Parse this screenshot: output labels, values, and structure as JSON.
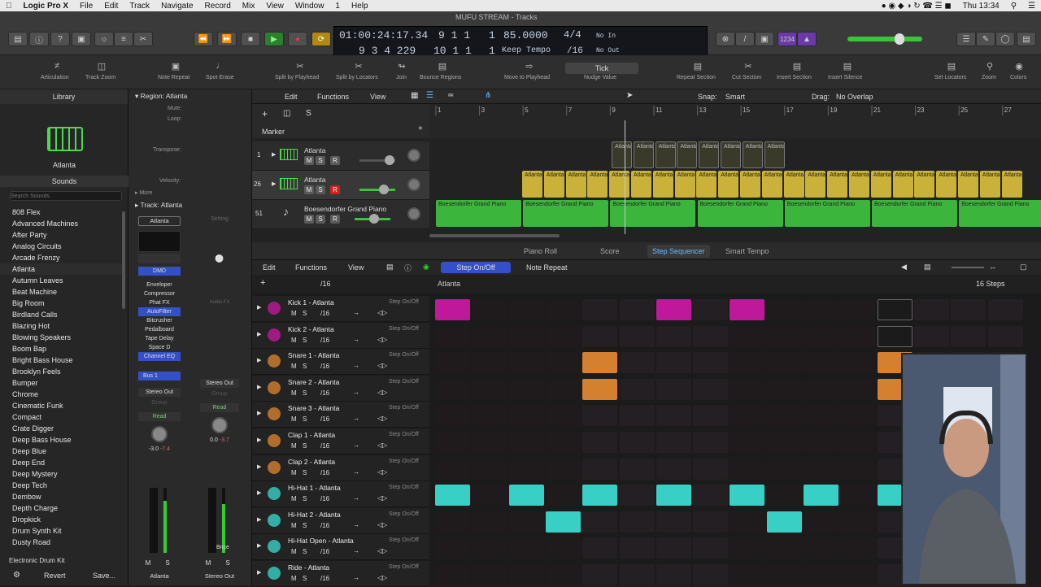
{
  "menubar": {
    "app": "Logic Pro X",
    "items": [
      "File",
      "Edit",
      "Track",
      "Navigate",
      "Record",
      "Mix",
      "View",
      "Window",
      "1",
      "Help"
    ],
    "clock": "Thu 13:34"
  },
  "window": {
    "title": "MUFU STREAM - Tracks"
  },
  "lcd": {
    "time": "01:00:24:17.34",
    "bars_top": "9 1 1",
    "bars_top2": "1",
    "bars_bottom": "9 3 4 229",
    "bars_bottom2": "10 1 1",
    "bars_bottom3": "1",
    "tempo": "85.0000",
    "tempo_mode": "Keep Tempo",
    "sig": "4/4",
    "div": "/16",
    "in": "No In",
    "out": "No Out"
  },
  "toolbar": {
    "items": [
      "Articulation",
      "Track Zoom",
      "Note Repeat",
      "Spot Erase",
      "Split by Playhead",
      "Split by Locators",
      "Join",
      "Bounce Regions",
      "Move to Playhead",
      "Nudge Value",
      "Repeat Section",
      "Cut Section",
      "Insert Section",
      "Insert Silence",
      "Set Locators",
      "Zoom",
      "Colors"
    ],
    "nudge": "Tick"
  },
  "library": {
    "title": "Library",
    "patch": "Atlanta",
    "sounds": "Sounds",
    "search_placeholder": "Search Sounds",
    "items": [
      "808 Flex",
      "Advanced Machines",
      "After Party",
      "Analog Circuits",
      "Arcade Frenzy",
      "Atlanta",
      "Autumn Leaves",
      "Beat Machine",
      "Big Room",
      "Birdland Calls",
      "Blazing Hot",
      "Blowing Speakers",
      "Boom Bap",
      "Bright Bass House",
      "Brooklyn Feels",
      "Bumper",
      "Chrome",
      "Cinematic Funk",
      "Compact",
      "Crate Digger",
      "Deep Bass House",
      "Deep Blue",
      "Deep End",
      "Deep Mystery",
      "Deep Tech",
      "Dembow",
      "Depth Charge",
      "Dropkick",
      "Drum Synth Kit",
      "Dusty Road"
    ],
    "footer": "Electronic Drum Kit",
    "revert": "Revert",
    "save": "Save..."
  },
  "inspector": {
    "region_label": "Region:",
    "region_name": "Atlanta",
    "mute": "Mute:",
    "loop": "Loop:",
    "transpose": "Transpose:",
    "velocity": "Velocity:",
    "more": "More",
    "track_label": "Track:",
    "track_name": "Atlanta",
    "strip_name": "Atlanta",
    "setting": "Setting",
    "dmd": "DMD",
    "plugins": [
      "Enveloper",
      "Compressor",
      "Phat FX",
      "AutoFilter",
      "Bitcrusher",
      "Pedalboard",
      "Tape Delay",
      "Space D",
      "Channel EQ"
    ],
    "bus": "Bus 1",
    "output": "Stereo Out",
    "group": "Group",
    "read1": "Read",
    "read2": "Read",
    "audiofx": "Audio FX",
    "vol1": "-3.0",
    "vol1b": "-7.4",
    "vol2": "0.0",
    "vol2b": "-3.7",
    "bnce": "Bnce",
    "m": "M",
    "s": "S",
    "name1": "Atlanta",
    "name2": "Stereo Out"
  },
  "tracks_area": {
    "edit": "Edit",
    "functions": "Functions",
    "view": "View",
    "snap_label": "Snap:",
    "snap": "Smart",
    "drag_label": "Drag:",
    "drag": "No Overlap",
    "marker": "Marker",
    "ruler": [
      "1",
      "3",
      "5",
      "7",
      "9",
      "11",
      "13",
      "15",
      "17",
      "19",
      "21",
      "23",
      "25",
      "27"
    ],
    "tracks": [
      {
        "num": "1",
        "name": "Atlanta"
      },
      {
        "num": "26",
        "name": "Atlanta"
      },
      {
        "num": "51",
        "name": "Boesendorfer Grand Piano"
      }
    ],
    "region_atl": "Atlanta",
    "region_piano": "Boesendorfer Grand Piano"
  },
  "editor": {
    "tabs": [
      "Piano Roll",
      "Score",
      "Step Sequencer",
      "Smart Tempo"
    ],
    "edit": "Edit",
    "functions": "Functions",
    "view": "View",
    "step_onoff": "Step On/Off",
    "note_repeat": "Note Repeat",
    "div": "/16",
    "pattern": "Atlanta",
    "steps": "16 Steps",
    "rows": [
      {
        "name": "Kick 1 - Atlanta",
        "color": "#c0189a",
        "steps": [
          1,
          0,
          0,
          0,
          0,
          0,
          1,
          0,
          1,
          0,
          0,
          0,
          2,
          0,
          0,
          0
        ]
      },
      {
        "name": "Kick 2 - Atlanta",
        "color": "#c0189a",
        "steps": [
          0,
          0,
          0,
          0,
          0,
          0,
          0,
          0,
          0,
          0,
          0,
          0,
          2,
          0,
          0,
          0
        ]
      },
      {
        "name": "Snare 1 - Atlanta",
        "color": "#d4802e",
        "steps": [
          0,
          0,
          0,
          0,
          1,
          0,
          0,
          0,
          0,
          0,
          0,
          0,
          1,
          0,
          0,
          0
        ]
      },
      {
        "name": "Snare 2 - Atlanta",
        "color": "#d4802e",
        "steps": [
          0,
          0,
          0,
          0,
          1,
          0,
          0,
          0,
          0,
          0,
          0,
          0,
          1,
          0,
          0,
          0
        ]
      },
      {
        "name": "Snare 3 - Atlanta",
        "color": "#d4802e",
        "steps": [
          0,
          0,
          0,
          0,
          0,
          0,
          0,
          0,
          0,
          0,
          0,
          0,
          0,
          0,
          0,
          0
        ]
      },
      {
        "name": "Clap 1 - Atlanta",
        "color": "#d4802e",
        "steps": [
          0,
          0,
          0,
          0,
          0,
          0,
          0,
          0,
          0,
          0,
          0,
          0,
          0,
          0,
          0,
          0
        ]
      },
      {
        "name": "Clap 2 - Atlanta",
        "color": "#d4802e",
        "steps": [
          0,
          0,
          0,
          0,
          0,
          0,
          0,
          0,
          0,
          0,
          0,
          0,
          0,
          0,
          0,
          0
        ]
      },
      {
        "name": "Hi-Hat 1 - Atlanta",
        "color": "#38d0c4",
        "steps": [
          1,
          0,
          1,
          0,
          1,
          0,
          1,
          0,
          1,
          0,
          1,
          0,
          1,
          0,
          0,
          0
        ]
      },
      {
        "name": "Hi-Hat 2 - Atlanta",
        "color": "#38d0c4",
        "steps": [
          0,
          0,
          0,
          1,
          0,
          0,
          0,
          0,
          0,
          1,
          0,
          0,
          0,
          0,
          0,
          0
        ]
      },
      {
        "name": "Hi-Hat Open - Atlanta",
        "color": "#38d0c4",
        "steps": [
          0,
          0,
          0,
          0,
          0,
          0,
          0,
          0,
          0,
          0,
          0,
          0,
          0,
          0,
          0,
          0
        ]
      },
      {
        "name": "Ride - Atlanta",
        "color": "#38d0c4",
        "steps": [
          0,
          0,
          0,
          0,
          0,
          0,
          0,
          0,
          0,
          0,
          0,
          0,
          0,
          0,
          0,
          0
        ]
      }
    ],
    "row_mode": "Step On/Off",
    "row_div": "/16",
    "m": "M",
    "s": "S"
  }
}
